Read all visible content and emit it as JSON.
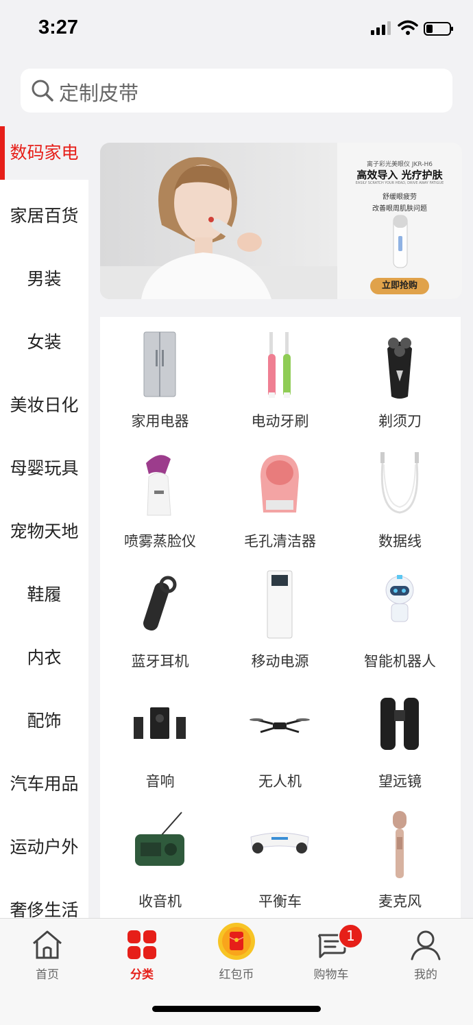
{
  "status": {
    "time": "3:27"
  },
  "search": {
    "placeholder": "定制皮带"
  },
  "sidebar": {
    "items": [
      {
        "label": "数码家电",
        "active": true
      },
      {
        "label": "家居百货"
      },
      {
        "label": "男装"
      },
      {
        "label": "女装"
      },
      {
        "label": "美妆日化"
      },
      {
        "label": "母婴玩具"
      },
      {
        "label": "宠物天地"
      },
      {
        "label": "鞋履"
      },
      {
        "label": "内衣"
      },
      {
        "label": "配饰"
      },
      {
        "label": "汽车用品"
      },
      {
        "label": "运动户外"
      },
      {
        "label": "奢侈生活"
      }
    ]
  },
  "banner": {
    "subtitle": "离子彩光美眼仪 JKR-H6",
    "title": "高效导入  光疗护肤",
    "english": "EASILY SCRATCH YOUR HEAD, DRIVE AWAY FATIGUE",
    "line1": "舒缓眼疲劳",
    "line2": "改善眼周肌肤问题",
    "button": "立即抢购"
  },
  "grid": {
    "items": [
      {
        "label": "家用电器",
        "icon": "refrigerator-icon"
      },
      {
        "label": "电动牙刷",
        "icon": "toothbrush-icon"
      },
      {
        "label": "剃须刀",
        "icon": "shaver-icon"
      },
      {
        "label": "喷雾蒸脸仪",
        "icon": "facial-steamer-icon"
      },
      {
        "label": "毛孔清洁器",
        "icon": "pore-cleaner-icon"
      },
      {
        "label": "数据线",
        "icon": "usb-cable-icon"
      },
      {
        "label": "蓝牙耳机",
        "icon": "bluetooth-headset-icon"
      },
      {
        "label": "移动电源",
        "icon": "power-bank-icon"
      },
      {
        "label": "智能机器人",
        "icon": "robot-icon"
      },
      {
        "label": "音响",
        "icon": "speaker-icon"
      },
      {
        "label": "无人机",
        "icon": "drone-icon"
      },
      {
        "label": "望远镜",
        "icon": "binoculars-icon"
      },
      {
        "label": "收音机",
        "icon": "radio-icon"
      },
      {
        "label": "平衡车",
        "icon": "hoverboard-icon"
      },
      {
        "label": "麦克风",
        "icon": "microphone-icon"
      }
    ]
  },
  "tabbar": {
    "items": [
      {
        "label": "首页",
        "icon": "home-icon"
      },
      {
        "label": "分类",
        "icon": "category-icon",
        "active": true
      },
      {
        "label": "红包币",
        "icon": "red-packet-icon"
      },
      {
        "label": "购物车",
        "icon": "cart-icon",
        "badge": "1"
      },
      {
        "label": "我的",
        "icon": "user-icon"
      }
    ]
  },
  "colors": {
    "accent": "#e61f19",
    "background": "#f2f2f4"
  }
}
